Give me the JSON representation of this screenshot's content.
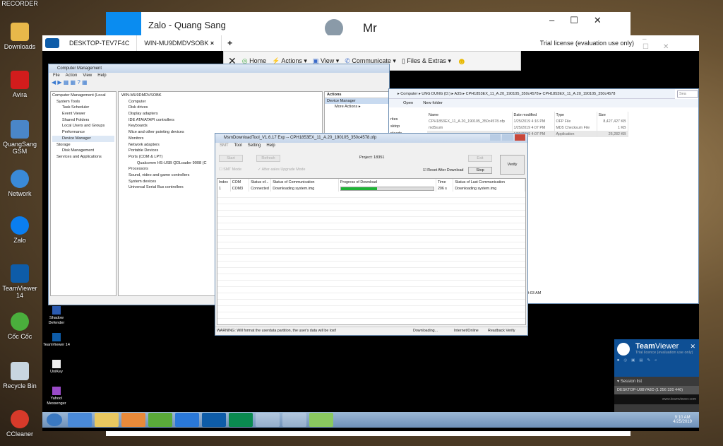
{
  "desktop": {
    "icons": [
      {
        "label": "RECORDER"
      },
      {
        "label": "Downloads"
      },
      {
        "label": "Avira"
      },
      {
        "label": "QuangSang GSM"
      },
      {
        "label": "Network"
      },
      {
        "label": "Zalo"
      },
      {
        "label": "TeamViewer 14"
      },
      {
        "label": "Cốc Cốc"
      },
      {
        "label": "Recycle Bin"
      },
      {
        "label": "CCleaner"
      }
    ]
  },
  "zalo": {
    "title": "Zalo - Quang Sang",
    "contact": "Mr"
  },
  "teamviewer": {
    "tabs": [
      {
        "label": "DESKTOP-TEV7F4C"
      },
      {
        "label": "WIN-MU9DMDVSOBK"
      }
    ],
    "add_tab": "+",
    "license": "Trial license (evaluation use only)",
    "toolbar": [
      {
        "label": "Home",
        "icon": "home-icon"
      },
      {
        "label": "Actions",
        "icon": "lightning-icon"
      },
      {
        "label": "View",
        "icon": "monitor-icon"
      },
      {
        "label": "Communicate",
        "icon": "phone-icon"
      },
      {
        "label": "Files & Extras",
        "icon": "file-icon"
      }
    ]
  },
  "compmgmt": {
    "title": "Computer Management",
    "menu": [
      "File",
      "Action",
      "View",
      "Help"
    ],
    "tree": [
      "Computer Management (Local",
      "System Tools",
      "Task Scheduler",
      "Event Viewer",
      "Shared Folders",
      "Local Users and Groups",
      "Performance",
      "Device Manager",
      "Storage",
      "Disk Management",
      "Services and Applications"
    ],
    "devices": [
      "WIN-MU9DMDVSOBK",
      "Computer",
      "Disk drives",
      "Display adapters",
      "IDE ATA/ATAPI controllers",
      "Keyboards",
      "Mice and other pointing devices",
      "Monitors",
      "Network adapters",
      "Portable Devices",
      "Ports (COM & LPT)",
      "Qualcomm HS-USB QDLoader 9008 (C",
      "Processors",
      "Sound, video and game controllers",
      "System devices",
      "Universal Serial Bus controllers"
    ],
    "actions": {
      "header": "Actions",
      "section": "Device Manager",
      "item": "More Actions"
    }
  },
  "explorer": {
    "breadcrumb": [
      "Computer",
      "UNG DUNG (D:)",
      "A3S",
      "CPH1853EX_11_A.20_190105_350c4578",
      "CPH1853EX_11_A.20_190105_350c4578"
    ],
    "search": "Sea",
    "toolbar": [
      "Open",
      "New folder"
    ],
    "nav": [
      "rites",
      "sktop",
      "nloads"
    ],
    "columns": [
      "Name",
      "Date modified",
      "Type",
      "Size"
    ],
    "files": [
      {
        "name": "CPH1853EX_11_A.20_190105_350c4578.ofp",
        "date": "1/25/2019 4:16 PM",
        "type": "OFP File",
        "size": "8,427,427 KB"
      },
      {
        "name": "md5sum",
        "date": "1/25/2019 4:07 PM",
        "type": "MD5 Checksum File",
        "size": "1 KB"
      },
      {
        "name": "",
        "date": "1/25/2019 4:07 PM",
        "type": "Application",
        "size": "26,282 KB"
      }
    ],
    "status": "ed: 4/25/2019 9:03 AM"
  },
  "msm": {
    "title": "MsmDownloadTool_V1.6.17 Exp -- CPH1853EX_11_A.20_190105_350c4578.ofp",
    "menu": [
      "SMT",
      "Tool",
      "Setting",
      "Help"
    ],
    "start": "Start",
    "refresh": "Refresh",
    "project": "Project: 18351",
    "exit": "Exit",
    "verify": "Verify",
    "stop": "Stop",
    "smt_mode": "SMT Mode",
    "aftersales": "After-sales Upgrade Mode",
    "reset": "Reset After Download",
    "reset_checked": true,
    "columns": [
      "Index",
      "COM",
      "Status of...",
      "Status of Communication",
      "Progress of Download",
      "Time",
      "Status of Last Communication"
    ],
    "rows": [
      {
        "index": "1",
        "com": "COM3",
        "status": "Connected",
        "comm": "Downloading system.img",
        "progress": 0.39,
        "time": "206 s",
        "last": "Downloading system.img"
      }
    ],
    "statusbar": {
      "warning": "WARNING: Will format the userdata partition, the user's data will be lost!",
      "state": "Downloading...",
      "net": "Internet/Online",
      "readback": "Readback Verify"
    }
  },
  "remote_icons": [
    {
      "label": "Shadow Defender"
    },
    {
      "label": "TeamViewer 14"
    },
    {
      "label": "UniKey"
    },
    {
      "label": "Yahoo! Messenger"
    }
  ],
  "tvpanel": {
    "title_a": "Team",
    "title_b": "Viewer",
    "sub": "Trial licence (evaluation use only)",
    "session_list": "Session list",
    "session": "DESKTOP-U8BYA8D (1 256 320 446)",
    "link": "www.teamviewer.com"
  },
  "clock": {
    "time": "9:10 AM",
    "date": "4/25/2019"
  },
  "colors": {
    "progress": "#1fb436",
    "tv_blue": "#0e5ca8",
    "accent": "#0078d7"
  }
}
